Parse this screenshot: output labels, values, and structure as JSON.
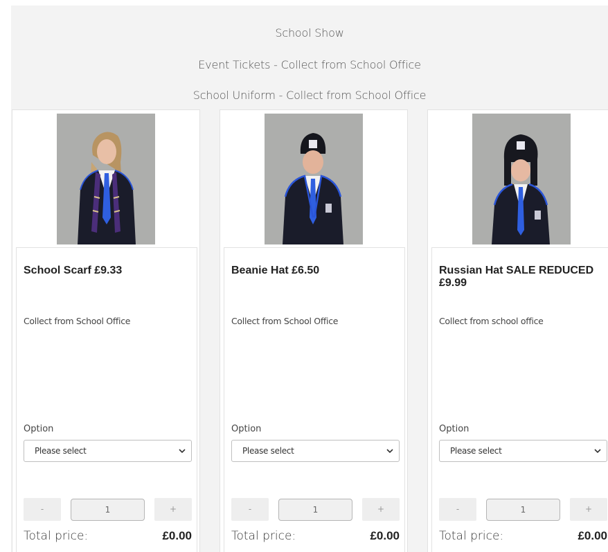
{
  "categories": [
    "School Show",
    "Event Tickets - Collect from School Office",
    "School Uniform - Collect from School Office"
  ],
  "products": [
    {
      "title": "School Scarf £9.33",
      "image": "student-wearing-school-scarf-photo",
      "description": "Collect from School Office",
      "option_label": "Option",
      "option_selected": "Please select",
      "qty_minus": "-",
      "qty_value": "1",
      "qty_plus": "+",
      "total_label": "Total price:",
      "total_value": "£0.00"
    },
    {
      "title": "Beanie Hat £6.50",
      "image": "student-wearing-beanie-hat-photo",
      "description": "Collect from School Office",
      "option_label": "Option",
      "option_selected": "Please select",
      "qty_minus": "-",
      "qty_value": "1",
      "qty_plus": "+",
      "total_label": "Total price:",
      "total_value": "£0.00"
    },
    {
      "title": "Russian Hat SALE REDUCED £9.99",
      "image": "student-wearing-russian-hat-photo",
      "description": "Collect from school office",
      "option_label": "Option",
      "option_selected": "Please select",
      "qty_minus": "-",
      "qty_value": "1",
      "qty_plus": "+",
      "total_label": "Total price:",
      "total_value": "£0.00"
    }
  ],
  "colors": {
    "panel_background": "#f3f3f3",
    "uniform_navy": "#1b1f3a",
    "uniform_blue_trim": "#2a55d8",
    "tie_blue": "#2f5fe0"
  }
}
